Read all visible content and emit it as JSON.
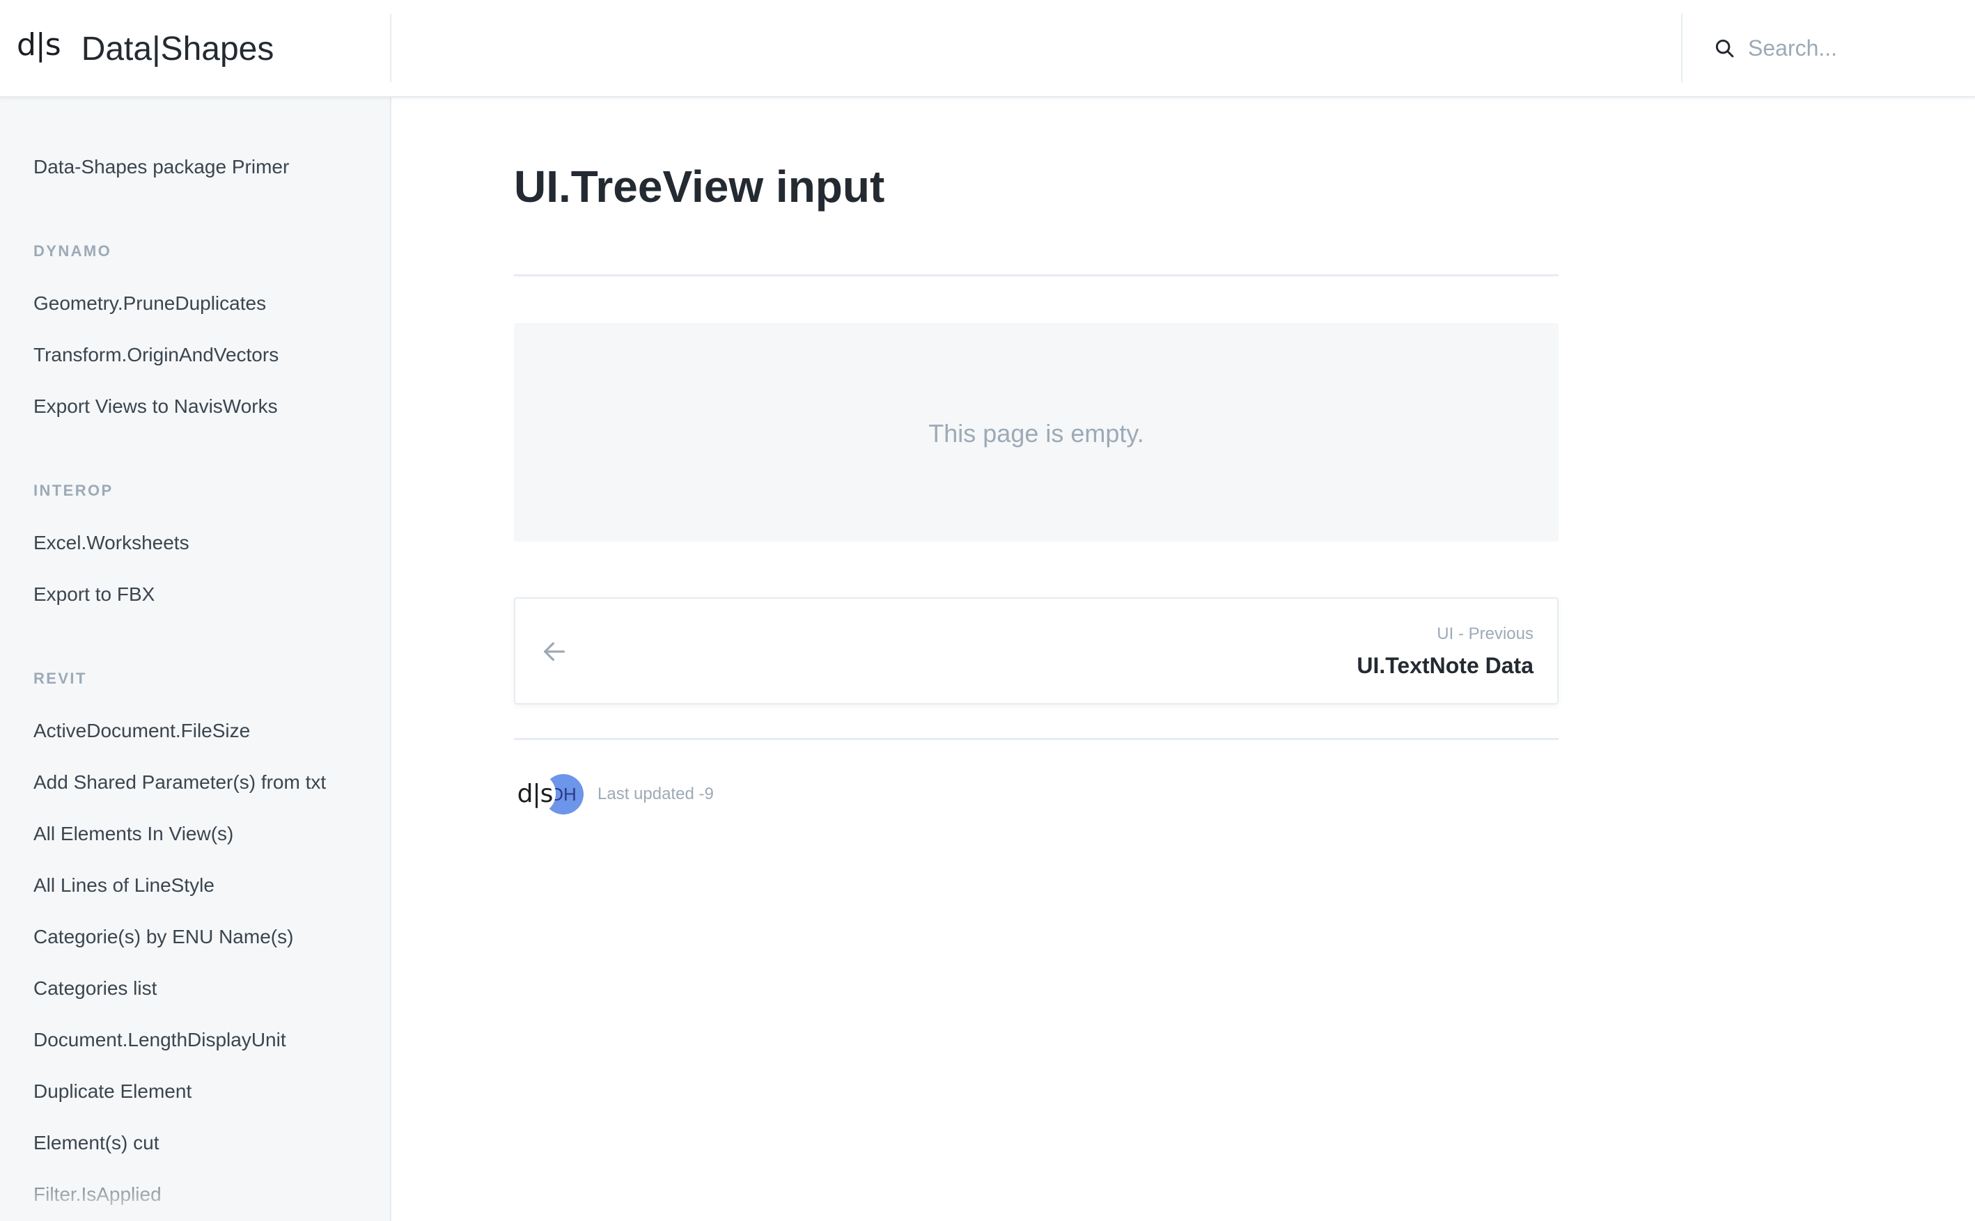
{
  "header": {
    "logo": "d|s",
    "brand_name": "Data|Shapes",
    "search": {
      "placeholder": "Search..."
    }
  },
  "sidebar": {
    "top_item": "Data-Shapes package Primer",
    "sections": [
      {
        "title": "DYNAMO",
        "items": [
          "Geometry.PruneDuplicates",
          "Transform.OriginAndVectors",
          "Export Views to NavisWorks"
        ]
      },
      {
        "title": "INTEROP",
        "items": [
          "Excel.Worksheets",
          "Export to FBX"
        ]
      },
      {
        "title": "REVIT",
        "items": [
          "ActiveDocument.FileSize",
          "Add Shared Parameter(s) from txt",
          "All Elements In View(s)",
          "All Lines of LineStyle",
          "Categorie(s) by ENU Name(s)",
          "Categories list",
          "Document.LengthDisplayUnit",
          "Duplicate Element",
          "Element(s) cut",
          "Filter.IsApplied"
        ]
      }
    ]
  },
  "main": {
    "title": "UI.TreeView input",
    "empty_message": "This page is empty.",
    "previous": {
      "meta": "UI - Previous",
      "title": "UI.TextNote Data"
    },
    "footer": {
      "avatar_1": "d|s",
      "avatar_2": "DH",
      "last_updated": "Last updated -9"
    }
  },
  "colors": {
    "text_primary": "#242a31",
    "text_secondary": "#3b454e",
    "text_muted": "#9daab6",
    "sidebar_bg": "#f5f7f9",
    "border": "#e6ecf1",
    "avatar_blue": "#6d95ea"
  }
}
